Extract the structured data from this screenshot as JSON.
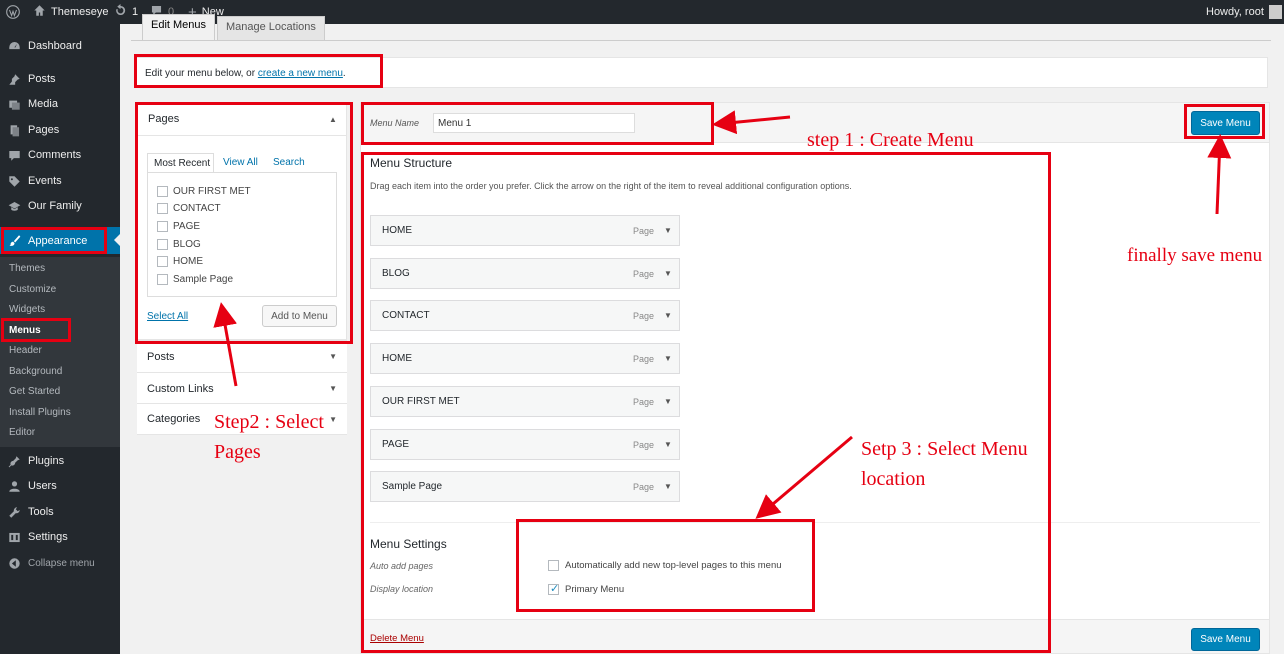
{
  "admin_bar": {
    "site_name": "Themeseye",
    "updates": "1",
    "comments": "0",
    "new_label": "New",
    "greeting": "Howdy, root"
  },
  "sidebar": {
    "items": [
      {
        "label": "Dashboard",
        "icon": "dashboard-icon"
      },
      {
        "label": "Posts",
        "icon": "pin-icon"
      },
      {
        "label": "Media",
        "icon": "media-icon"
      },
      {
        "label": "Pages",
        "icon": "pages-icon"
      },
      {
        "label": "Comments",
        "icon": "comment-icon"
      },
      {
        "label": "Events",
        "icon": "tag-icon"
      },
      {
        "label": "Our Family",
        "icon": "graduation-cap-icon"
      },
      {
        "label": "Appearance",
        "icon": "paintbrush-icon"
      },
      {
        "label": "Plugins",
        "icon": "plugin-icon"
      },
      {
        "label": "Users",
        "icon": "user-icon"
      },
      {
        "label": "Tools",
        "icon": "wrench-icon"
      },
      {
        "label": "Settings",
        "icon": "settings-icon"
      },
      {
        "label": "Collapse menu",
        "icon": "collapse-icon"
      }
    ],
    "submenu": [
      "Themes",
      "Customize",
      "Widgets",
      "Menus",
      "Header",
      "Background",
      "Get Started",
      "Install Plugins",
      "Editor"
    ]
  },
  "tabs": {
    "edit": "Edit Menus",
    "manage": "Manage Locations"
  },
  "notice": {
    "text": "Edit your menu below, or ",
    "link": "create a new menu",
    "end": "."
  },
  "pages_box": {
    "title": "Pages",
    "tabs": [
      "Most Recent",
      "View All",
      "Search"
    ],
    "items": [
      "OUR FIRST MET",
      "CONTACT",
      "PAGE",
      "BLOG",
      "HOME",
      "Sample Page"
    ],
    "select_all": "Select All",
    "add_button": "Add to Menu"
  },
  "accordion": [
    "Posts",
    "Custom Links",
    "Categories"
  ],
  "menu_name": {
    "label": "Menu Name",
    "value": "Menu 1"
  },
  "save_label": "Save Menu",
  "structure": {
    "title": "Menu Structure",
    "desc": "Drag each item into the order you prefer. Click the arrow on the right of the item to reveal additional configuration options.",
    "items": [
      {
        "title": "HOME",
        "type": "Page"
      },
      {
        "title": "BLOG",
        "type": "Page"
      },
      {
        "title": "CONTACT",
        "type": "Page"
      },
      {
        "title": "HOME",
        "type": "Page"
      },
      {
        "title": "OUR FIRST MET",
        "type": "Page"
      },
      {
        "title": "PAGE",
        "type": "Page"
      },
      {
        "title": "Sample Page",
        "type": "Page"
      }
    ]
  },
  "settings": {
    "title": "Menu Settings",
    "auto_label": "Auto add pages",
    "auto_text": "Automatically add new top-level pages to this menu",
    "display_label": "Display location",
    "primary_text": "Primary Menu",
    "auto_checked": false,
    "primary_checked": true
  },
  "delete_label": "Delete Menu",
  "annotations": {
    "step1": "step 1 : Create Menu",
    "step2_line1": "Step2 : Select",
    "step2_line2": "Pages",
    "step3_line1": "Setp 3 : Select Menu",
    "step3_line2": "location",
    "final": "finally save menu"
  },
  "colors": {
    "accent": "#0073aa",
    "annotation": "#e60012",
    "sidebar_bg": "#23282d"
  }
}
